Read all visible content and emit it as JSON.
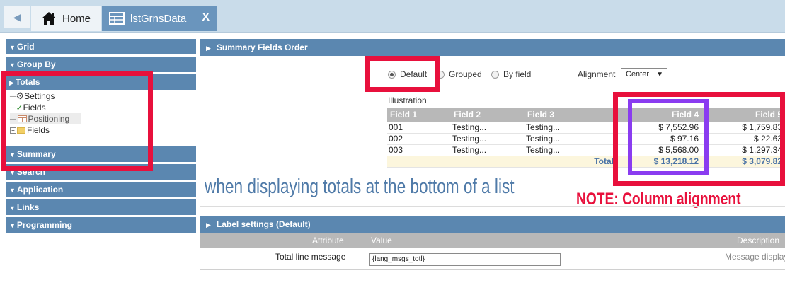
{
  "tabs": {
    "home_label": "Home",
    "data_label": "lstGrnsData",
    "close_label": "X"
  },
  "sidebar": {
    "sections": [
      "Grid",
      "Group By",
      "Totals",
      "Summary",
      "Search",
      "Application",
      "Links",
      "Programming"
    ],
    "tree": [
      "Settings",
      "Fields",
      "Positioning",
      "Fields"
    ]
  },
  "summary_order": {
    "title": "Summary Fields Order",
    "options": [
      "Default",
      "Grouped",
      "By field"
    ],
    "selected": "Default",
    "alignment_label": "Alignment",
    "alignment_value": "Center"
  },
  "illustration": {
    "label": "Illustration",
    "columns": [
      "Field 1",
      "Field 2",
      "Field 3",
      "Field 4",
      "Field 5"
    ],
    "rows": [
      [
        "001",
        "Testing...",
        "Testing...",
        "$ 7,552.96",
        "$ 1,759.83"
      ],
      [
        "002",
        "Testing...",
        "Testing...",
        "$ 97.16",
        "$ 22.63"
      ],
      [
        "003",
        "Testing...",
        "Testing...",
        "$ 5,568.00",
        "$ 1,297.34"
      ]
    ],
    "total_label": "Total",
    "total_field4": "$ 13,218.12",
    "total_field5": "$ 3,079.82"
  },
  "annotations": {
    "caption": "when displaying totals at the bottom of a list",
    "note": "NOTE:  Column alignment"
  },
  "label_settings": {
    "title": "Label settings (Default)",
    "col_attribute": "Attribute",
    "col_value": "Value",
    "col_description": "Description",
    "row_attribute": "Total line message",
    "row_value": "{lang_msgs_totl}",
    "row_description": "Message display"
  },
  "colors": {
    "accent": "#5b87b0",
    "annotation_red": "#e8103c",
    "annotation_purple": "#8a3cf0"
  }
}
